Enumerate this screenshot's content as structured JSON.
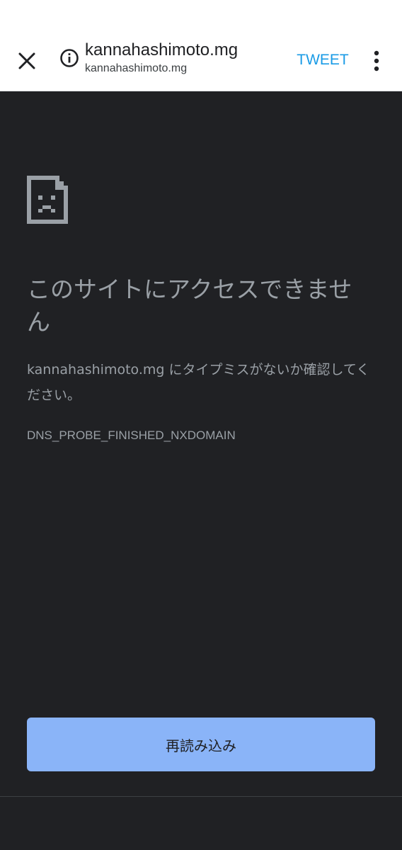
{
  "toolbar": {
    "title": "kannahashimoto.mg",
    "url": "kannahashimoto.mg",
    "tweet_label": "TWEET",
    "icons": {
      "close": "close-icon",
      "info": "info-icon",
      "menu": "more-vert-icon"
    }
  },
  "error": {
    "icon": "sad-page-icon",
    "heading": "このサイトにアクセスできません",
    "message": "kannahashimoto.mg にタイプミスがないか確認してください。",
    "code": "DNS_PROBE_FINISHED_NXDOMAIN",
    "reload_label": "再読み込み"
  },
  "colors": {
    "background": "#202124",
    "text_muted": "#9aa0a6",
    "accent_button": "#8ab4f8",
    "tweet_link": "#1a9be6"
  }
}
